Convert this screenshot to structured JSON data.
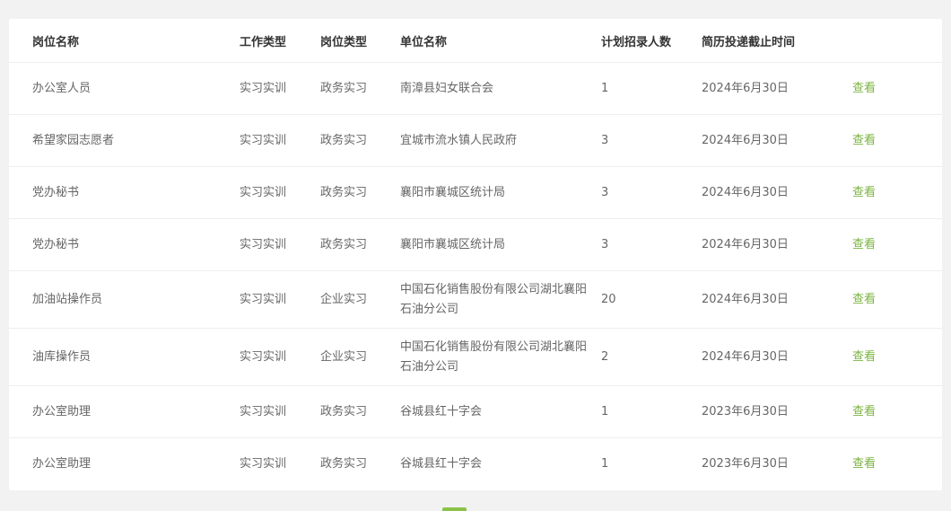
{
  "table": {
    "headers": {
      "position": "岗位名称",
      "work_type": "工作类型",
      "position_type": "岗位类型",
      "company": "单位名称",
      "quota": "计划招录人数",
      "deadline": "简历投递截止时间",
      "action": ""
    },
    "rows": [
      {
        "position": "办公室人员",
        "work_type": "实习实训",
        "position_type": "政务实习",
        "company": "南漳县妇女联合会",
        "quota": "1",
        "deadline": "2024年6月30日",
        "action": "查看"
      },
      {
        "position": "希望家园志愿者",
        "work_type": "实习实训",
        "position_type": "政务实习",
        "company": "宜城市流水镇人民政府",
        "quota": "3",
        "deadline": "2024年6月30日",
        "action": "查看"
      },
      {
        "position": "党办秘书",
        "work_type": "实习实训",
        "position_type": "政务实习",
        "company": "襄阳市襄城区统计局",
        "quota": "3",
        "deadline": "2024年6月30日",
        "action": "查看"
      },
      {
        "position": "党办秘书",
        "work_type": "实习实训",
        "position_type": "政务实习",
        "company": "襄阳市襄城区统计局",
        "quota": "3",
        "deadline": "2024年6月30日",
        "action": "查看"
      },
      {
        "position": "加油站操作员",
        "work_type": "实习实训",
        "position_type": "企业实习",
        "company": "中国石化销售股份有限公司湖北襄阳石油分公司",
        "quota": "20",
        "deadline": "2024年6月30日",
        "action": "查看"
      },
      {
        "position": "油库操作员",
        "work_type": "实习实训",
        "position_type": "企业实习",
        "company": "中国石化销售股份有限公司湖北襄阳石油分公司",
        "quota": "2",
        "deadline": "2024年6月30日",
        "action": "查看"
      },
      {
        "position": "办公室助理",
        "work_type": "实习实训",
        "position_type": "政务实习",
        "company": "谷城县红十字会",
        "quota": "1",
        "deadline": "2023年6月30日",
        "action": "查看"
      },
      {
        "position": "办公室助理",
        "work_type": "实习实训",
        "position_type": "政务实习",
        "company": "谷城县红十字会",
        "quota": "1",
        "deadline": "2023年6月30日",
        "action": "查看"
      }
    ]
  },
  "colors": {
    "link": "#7cb342",
    "page_bg": "#f1f2f1",
    "pager_active": "#8bc34a"
  }
}
